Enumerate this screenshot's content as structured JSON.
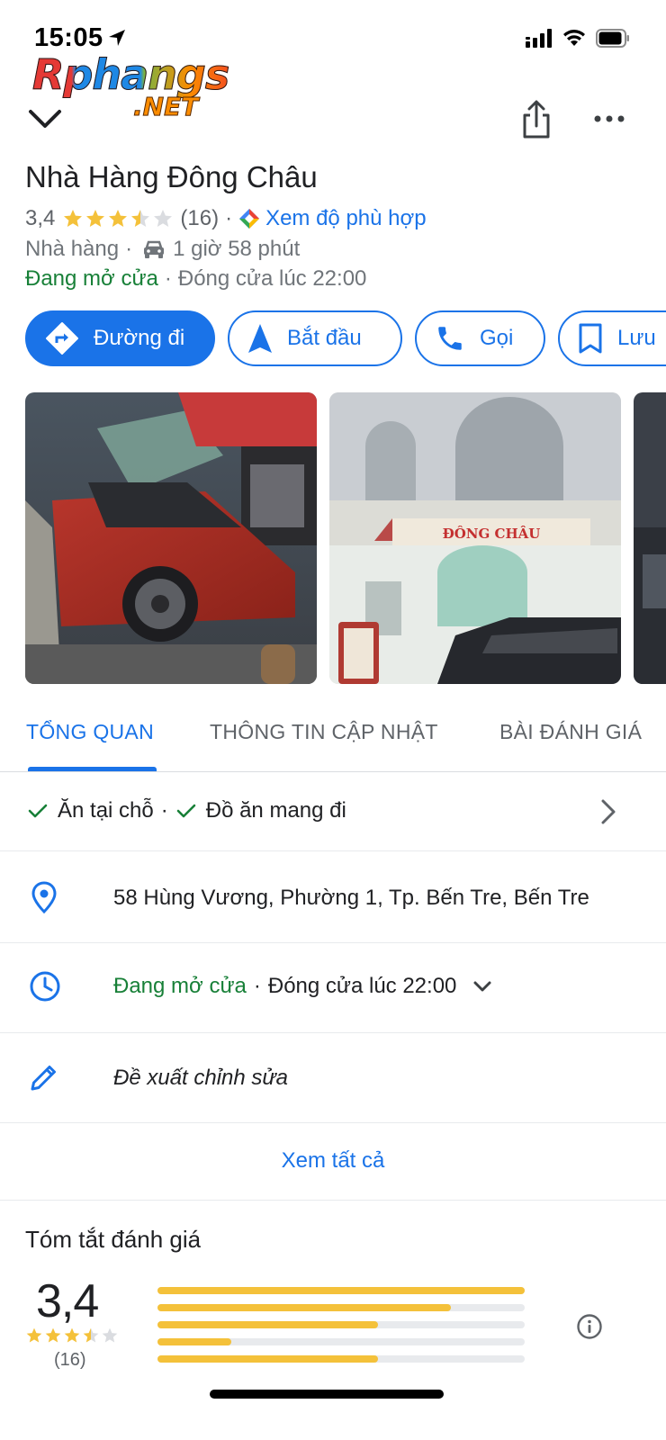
{
  "status_bar": {
    "time": "15:05"
  },
  "watermark": {
    "main": "Rphangs",
    "sub": ".NET"
  },
  "place": {
    "title": "Nhà Hàng Đông Châu",
    "rating": "3,4",
    "rating_value": 3.4,
    "review_count": "(16)",
    "separator": "·",
    "fit_label": "Xem độ phù hợp",
    "category": "Nhà hàng",
    "drive_time": "1 giờ 58 phút",
    "open_status": "Đang mở cửa",
    "closing": "Đóng cửa lúc 22:00"
  },
  "actions": {
    "directions": "Đường đi",
    "start": "Bắt đầu",
    "call": "Gọi",
    "save": "Lưu"
  },
  "tabs": [
    "TỔNG QUAN",
    "THÔNG TIN CẬP NHẬT",
    "BÀI ĐÁNH GIÁ"
  ],
  "services": {
    "dine_in": "Ăn tại chỗ",
    "separator": "·",
    "takeout": "Đồ ăn mang đi"
  },
  "address": "58 Hùng Vương, Phường 1, Tp. Bến Tre, Bến Tre",
  "hours": {
    "status": "Đang mở cửa",
    "closing": "Đóng cửa lúc 22:00"
  },
  "suggest_edit": "Đề xuất chỉnh sửa",
  "see_all": "Xem tất cả",
  "review_summary": {
    "title": "Tóm tắt đánh giá",
    "rating": "3,4",
    "count": "(16)",
    "distribution_fraction": [
      1.0,
      0.8,
      0.6,
      0.2,
      0.6
    ]
  },
  "colors": {
    "accent": "#1a73e8",
    "open_green": "#188038",
    "star": "#f4c13a",
    "star_empty": "#dadce0"
  }
}
